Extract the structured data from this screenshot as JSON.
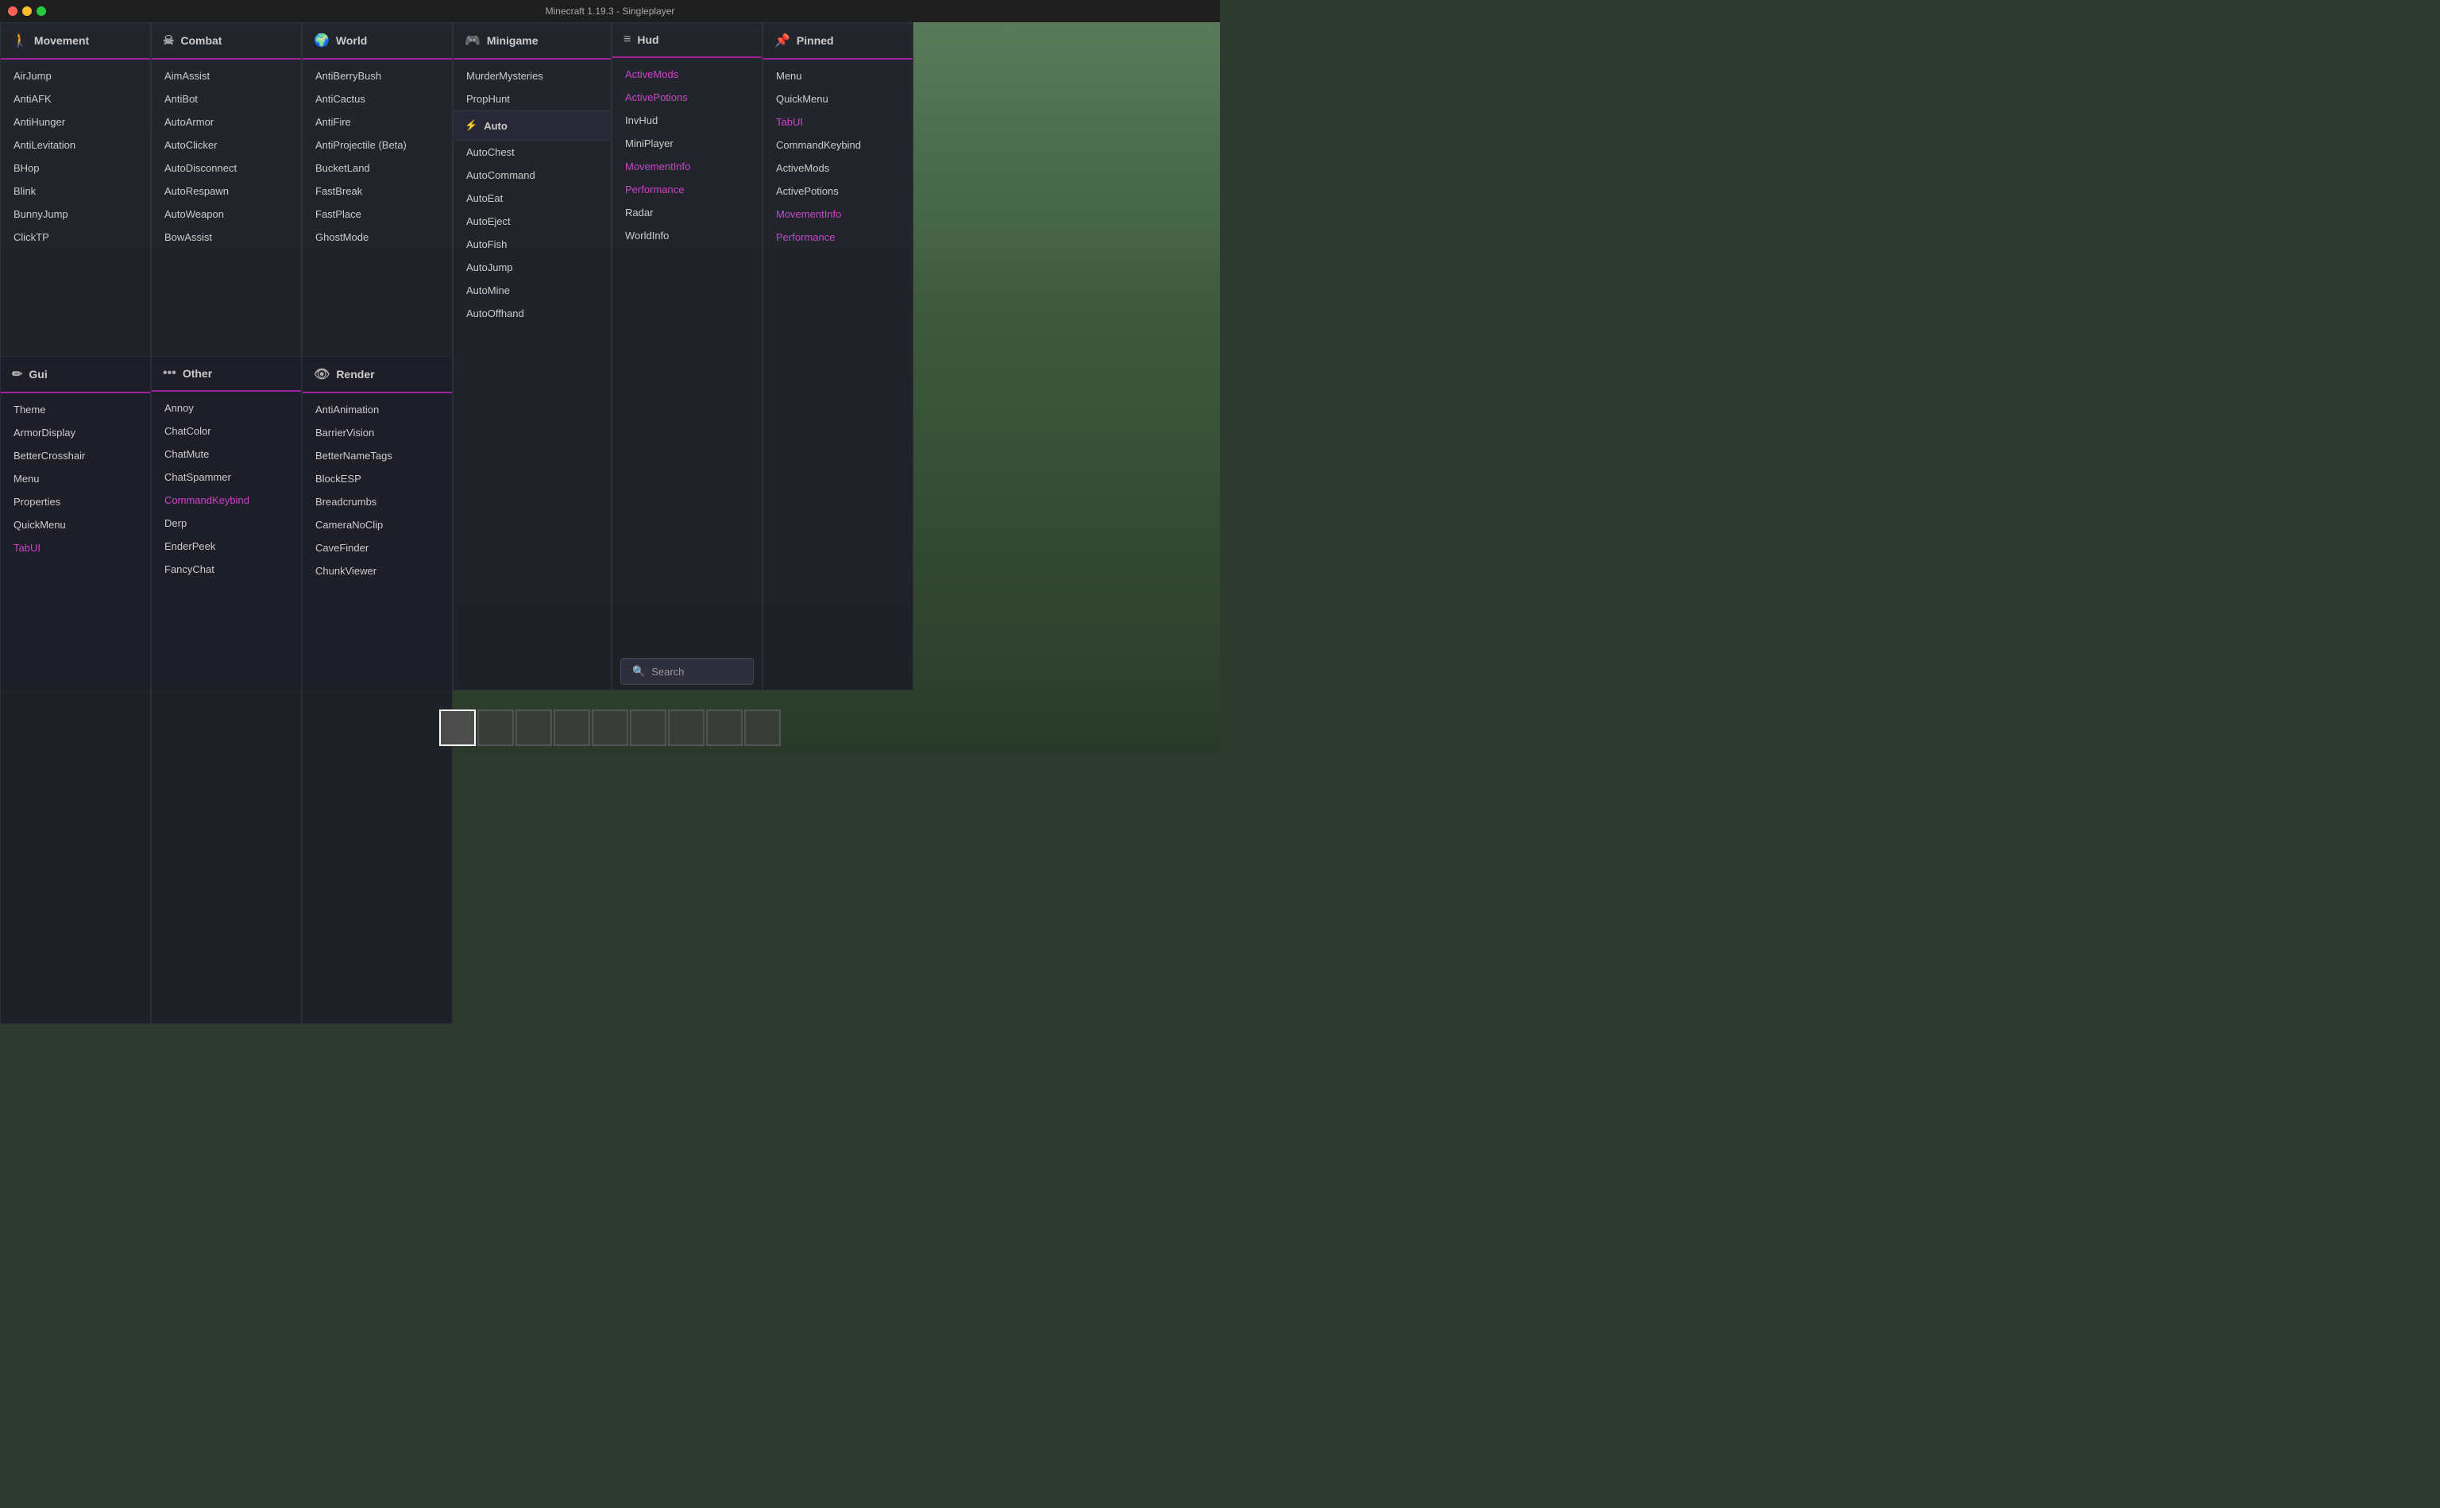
{
  "app": {
    "title": "Minecraft 1.19.3 - Singleplayer"
  },
  "panels": {
    "movement": {
      "label": "Movement",
      "icon": "🚶",
      "items": [
        {
          "label": "AirJump",
          "active": false
        },
        {
          "label": "AntiAFK",
          "active": false
        },
        {
          "label": "AntiHunger",
          "active": false
        },
        {
          "label": "AntiLevitation",
          "active": false
        },
        {
          "label": "BHop",
          "active": false
        },
        {
          "label": "Blink",
          "active": false
        },
        {
          "label": "BunnyJump",
          "active": false
        },
        {
          "label": "ClickTP",
          "active": false
        }
      ]
    },
    "combat": {
      "label": "Combat",
      "icon": "💀",
      "items": [
        {
          "label": "AimAssist",
          "active": false
        },
        {
          "label": "AntiBot",
          "active": false
        },
        {
          "label": "AutoArmor",
          "active": false
        },
        {
          "label": "AutoClicker",
          "active": false
        },
        {
          "label": "AutoDisconnect",
          "active": false
        },
        {
          "label": "AutoRespawn",
          "active": false
        },
        {
          "label": "AutoWeapon",
          "active": false
        },
        {
          "label": "BowAssist",
          "active": false
        }
      ]
    },
    "world": {
      "label": "World",
      "icon": "🌍",
      "items": [
        {
          "label": "AntiBerryBush",
          "active": false
        },
        {
          "label": "AntiCactus",
          "active": false
        },
        {
          "label": "AntiFire",
          "active": false
        },
        {
          "label": "AntiProjectile (Beta)",
          "active": false
        },
        {
          "label": "BucketLand",
          "active": false
        },
        {
          "label": "FastBreak",
          "active": false
        },
        {
          "label": "FastPlace",
          "active": false
        },
        {
          "label": "GhostMode",
          "active": false
        }
      ]
    },
    "minigame": {
      "label": "Minigame",
      "icon": "🎮",
      "top_items": [
        {
          "label": "MurderMysteries",
          "active": false
        },
        {
          "label": "PropHunt",
          "active": false
        }
      ],
      "sub_label": "Auto",
      "sub_icon": "⚡",
      "sub_items": [
        {
          "label": "AutoChest",
          "active": false
        },
        {
          "label": "AutoCommand",
          "active": false
        },
        {
          "label": "AutoEat",
          "active": false
        },
        {
          "label": "AutoEject",
          "active": false
        },
        {
          "label": "AutoFish",
          "active": false
        },
        {
          "label": "AutoJump",
          "active": false
        },
        {
          "label": "AutoMine",
          "active": false
        },
        {
          "label": "AutoOffhand",
          "active": false
        }
      ]
    },
    "hud": {
      "label": "Hud",
      "icon": "≡",
      "items": [
        {
          "label": "ActiveMods",
          "active": true,
          "purple": true
        },
        {
          "label": "ActivePotions",
          "active": true,
          "purple": true
        },
        {
          "label": "InvHud",
          "active": false
        },
        {
          "label": "MiniPlayer",
          "active": false
        },
        {
          "label": "MovementInfo",
          "active": true,
          "purple": true
        },
        {
          "label": "Performance",
          "active": true,
          "purple": true
        },
        {
          "label": "Radar",
          "active": false
        },
        {
          "label": "WorldInfo",
          "active": false
        }
      ],
      "search_placeholder": "Search",
      "search_icon": "🔍"
    },
    "pinned": {
      "label": "Pinned",
      "icon": "📌",
      "items": [
        {
          "label": "Menu",
          "active": false
        },
        {
          "label": "QuickMenu",
          "active": false
        },
        {
          "label": "TabUI",
          "active": true,
          "purple": true
        },
        {
          "label": "CommandKeybind",
          "active": false
        },
        {
          "label": "ActiveMods",
          "active": false
        },
        {
          "label": "ActivePotions",
          "active": false
        },
        {
          "label": "MovementInfo",
          "active": true,
          "purple": true
        },
        {
          "label": "Performance",
          "active": true,
          "purple": true
        }
      ]
    },
    "gui": {
      "label": "Gui",
      "icon": "✏️",
      "items": [
        {
          "label": "Theme",
          "active": false
        },
        {
          "label": "ArmorDisplay",
          "active": false
        },
        {
          "label": "BetterCrosshair",
          "active": false
        },
        {
          "label": "Menu",
          "active": false
        },
        {
          "label": "Properties",
          "active": false
        },
        {
          "label": "QuickMenu",
          "active": false
        },
        {
          "label": "TabUI",
          "active": true,
          "purple": true
        }
      ]
    },
    "other": {
      "label": "Other",
      "icon": "•••",
      "items": [
        {
          "label": "Annoy",
          "active": false
        },
        {
          "label": "ChatColor",
          "active": false
        },
        {
          "label": "ChatMute",
          "active": false
        },
        {
          "label": "ChatSpammer",
          "active": false
        },
        {
          "label": "CommandKeybind",
          "active": true,
          "purple": true
        },
        {
          "label": "Derp",
          "active": false
        },
        {
          "label": "EnderPeek",
          "active": false
        },
        {
          "label": "FancyChat",
          "active": false
        }
      ]
    },
    "render": {
      "label": "Render",
      "icon": "👁",
      "items": [
        {
          "label": "AntiAnimation",
          "active": false
        },
        {
          "label": "BarrierVision",
          "active": false
        },
        {
          "label": "BetterNameTags",
          "active": false
        },
        {
          "label": "BlockESP",
          "active": false
        },
        {
          "label": "Breadcrumbs",
          "active": false
        },
        {
          "label": "CameraNoClip",
          "active": false
        },
        {
          "label": "CaveFinder",
          "active": false
        },
        {
          "label": "ChunkViewer",
          "active": false
        }
      ]
    }
  },
  "hotbar": {
    "slots": [
      {
        "active": true
      },
      {
        "active": false
      },
      {
        "active": false
      },
      {
        "active": false
      },
      {
        "active": false
      },
      {
        "active": false
      },
      {
        "active": false
      },
      {
        "active": false
      },
      {
        "active": false
      }
    ]
  }
}
